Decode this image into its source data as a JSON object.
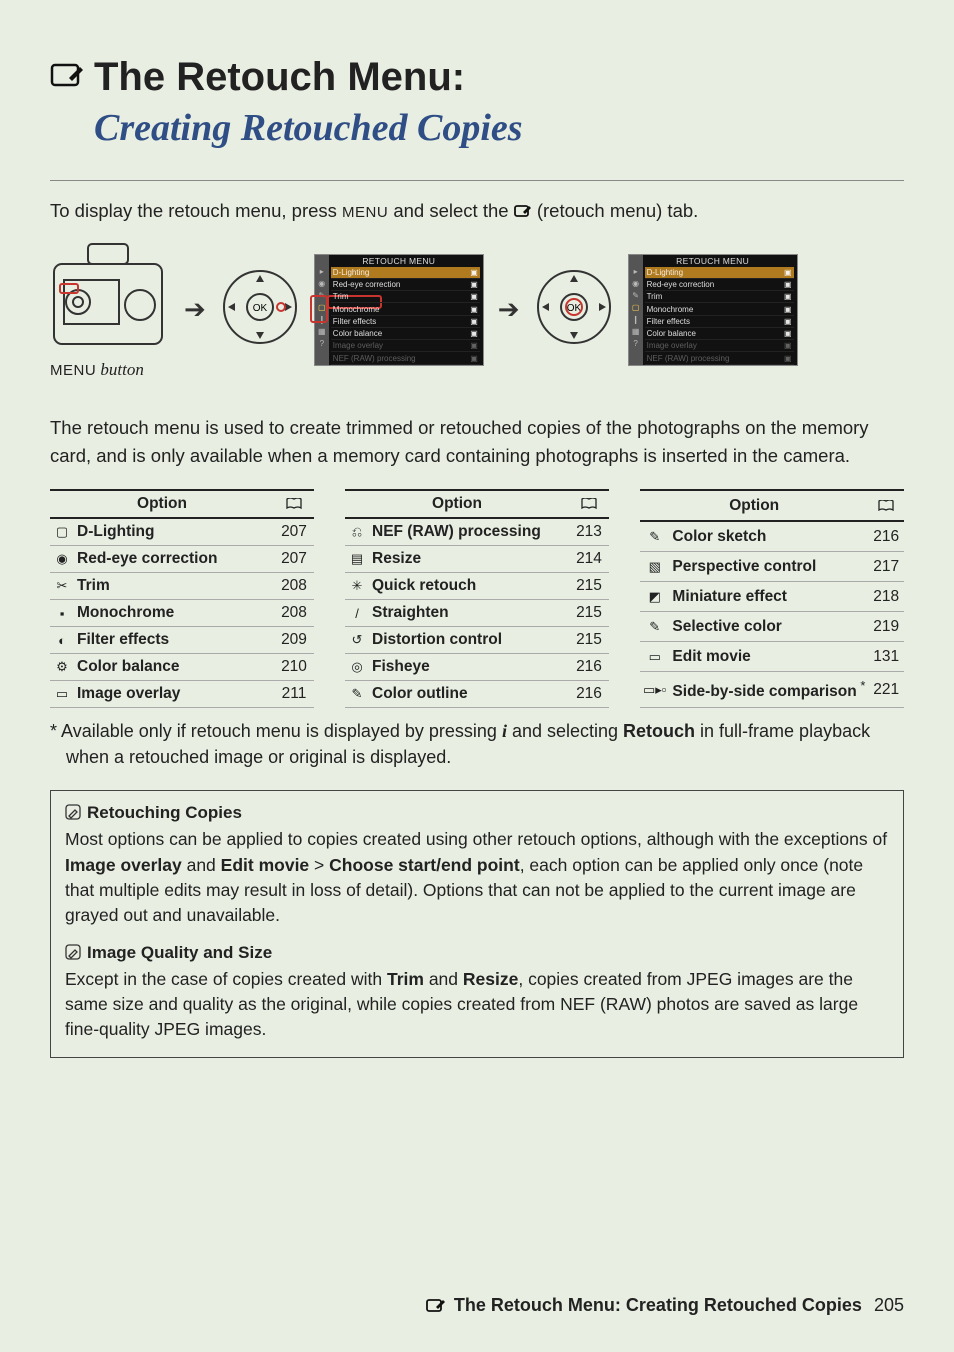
{
  "header": {
    "title": "The Retouch Menu:",
    "subtitle": "Creating Retouched Copies"
  },
  "intro": "To display the retouch menu, press ",
  "intro_mid": " and select the ",
  "intro_end": " (retouch menu) tab.",
  "menu_button_glyph": "MENU",
  "menu_button_caption": " button",
  "menu_screenshot": {
    "title": "RETOUCH MENU",
    "rows": [
      {
        "label": "D-Lighting",
        "hl": true
      },
      {
        "label": "Red-eye correction"
      },
      {
        "label": "Trim"
      },
      {
        "label": "Monochrome"
      },
      {
        "label": "Filter effects"
      },
      {
        "label": "Color balance"
      },
      {
        "label": "Image overlay",
        "greyed": true
      },
      {
        "label": "NEF (RAW) processing",
        "greyed": true
      }
    ]
  },
  "body": "The retouch menu is used to create trimmed or retouched copies of the photographs on the memory card, and is only available when a memory card containing photographs is inserted in the camera.",
  "tables": [
    {
      "header_option": "Option",
      "rows": [
        {
          "opt": "D-Lighting",
          "pg": "207"
        },
        {
          "opt": "Red-eye correction",
          "pg": "207"
        },
        {
          "opt": "Trim",
          "pg": "208"
        },
        {
          "opt": "Monochrome",
          "pg": "208"
        },
        {
          "opt": "Filter effects",
          "pg": "209"
        },
        {
          "opt": "Color balance",
          "pg": "210"
        },
        {
          "opt": "Image overlay",
          "pg": "211"
        }
      ]
    },
    {
      "header_option": "Option",
      "rows": [
        {
          "opt": "NEF (RAW) processing",
          "pg": "213"
        },
        {
          "opt": "Resize",
          "pg": "214"
        },
        {
          "opt": "Quick retouch",
          "pg": "215"
        },
        {
          "opt": "Straighten",
          "pg": "215"
        },
        {
          "opt": "Distortion control",
          "pg": "215"
        },
        {
          "opt": "Fisheye",
          "pg": "216"
        },
        {
          "opt": "Color outline",
          "pg": "216"
        }
      ]
    },
    {
      "header_option": "Option",
      "rows": [
        {
          "opt": "Color sketch",
          "pg": "216"
        },
        {
          "opt": "Perspective control",
          "pg": "217"
        },
        {
          "opt": "Miniature effect",
          "pg": "218"
        },
        {
          "opt": "Selective color",
          "pg": "219"
        },
        {
          "opt": "Edit movie",
          "pg": "131"
        },
        {
          "opt": "Side-by-side comparison",
          "pg": "221",
          "asterisk": "*",
          "rowspan": 2
        }
      ]
    }
  ],
  "footnote": {
    "prefix": "*  Available only if retouch menu is displayed by pressing ",
    "mid": " and selecting ",
    "retouch": "Retouch",
    "suffix": " in full-frame playback when a retouched image or original is displayed."
  },
  "box1": {
    "title": "Retouching Copies",
    "body_a": "Most options can be applied to copies created using other retouch options, although with the exceptions of ",
    "b1": "Image overlay",
    "body_b": " and ",
    "b2": "Edit movie",
    "sep": " > ",
    "b3": "Choose start/end point",
    "body_c": ", each option can be applied only once (note that multiple edits may result in loss of detail).  Options that can not be applied to the current image are grayed out and unavailable."
  },
  "box2": {
    "title": "Image Quality and Size",
    "body_a": "Except in the case of copies created with ",
    "b1": "Trim",
    "body_b": " and ",
    "b2": "Resize",
    "body_c": ", copies created from JPEG images are the same size and quality as the original, while copies created from NEF (RAW) photos are saved as large fine-quality JPEG images."
  },
  "footer": {
    "text": "The Retouch Menu: Creating Retouched Copies",
    "page": "205"
  }
}
